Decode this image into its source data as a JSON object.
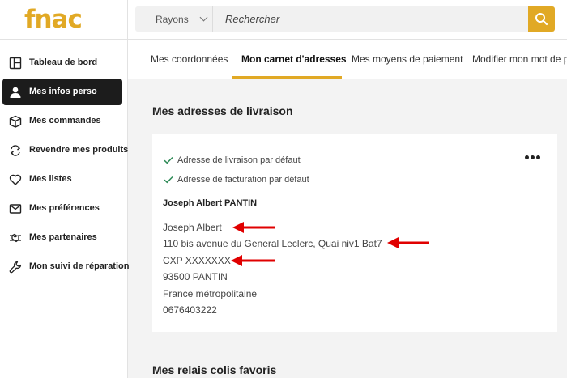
{
  "header": {
    "logo": "fnac",
    "rayons_label": "Rayons",
    "search_placeholder": "Rechercher",
    "accent_color": "#e1a925"
  },
  "sidebar": {
    "items": [
      {
        "label": "Tableau de bord",
        "icon": "dashboard-icon",
        "active": false
      },
      {
        "label": "Mes infos perso",
        "icon": "user-icon",
        "active": true
      },
      {
        "label": "Mes commandes",
        "icon": "box-icon",
        "active": false
      },
      {
        "label": "Revendre mes produits",
        "icon": "resell-icon",
        "active": false
      },
      {
        "label": "Mes listes",
        "icon": "heart-icon",
        "active": false
      },
      {
        "label": "Mes préférences",
        "icon": "mail-icon",
        "active": false
      },
      {
        "label": "Mes partenaires",
        "icon": "handshake-icon",
        "active": false
      },
      {
        "label": "Mon suivi de réparation",
        "icon": "wrench-icon",
        "active": false
      }
    ]
  },
  "tabs": [
    {
      "label": "Mes coordonnées",
      "active": false
    },
    {
      "label": "Mon carnet d'adresses",
      "active": true
    },
    {
      "label": "Mes moyens de paiement",
      "active": false
    },
    {
      "label": "Modifier mon mot de pa",
      "active": false
    }
  ],
  "main": {
    "delivery_title": "Mes adresses de livraison",
    "relay_title": "Mes relais colis favoris",
    "address_card": {
      "defaults": [
        "Adresse de livraison par défaut",
        "Adresse de facturation par défaut"
      ],
      "name": "Joseph Albert PANTIN",
      "lines": [
        "Joseph Albert",
        "110 bis avenue du General Leclerc, Quai niv1 Bat7",
        "CXP XXXXXXX",
        "93500 PANTIN",
        "France métropolitaine",
        "0676403222"
      ],
      "annotation_color": "#e00000"
    }
  }
}
